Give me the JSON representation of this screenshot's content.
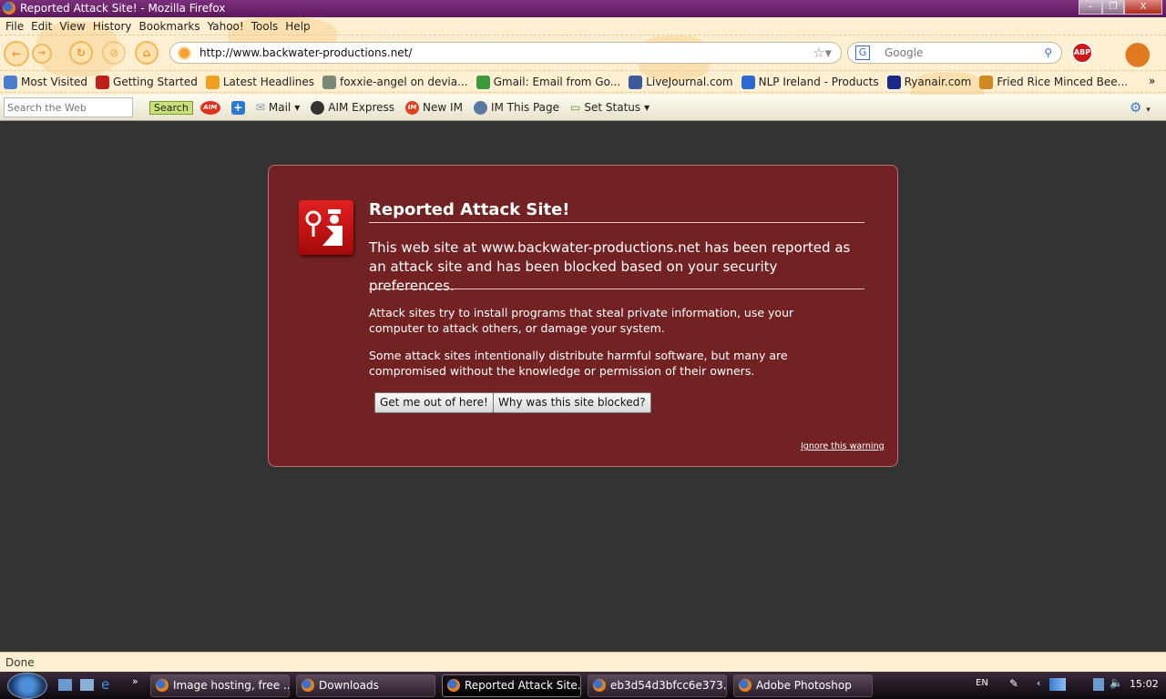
{
  "window": {
    "title": "Reported Attack Site! - Mozilla Firefox",
    "minimize": "–",
    "restore": "❐",
    "close": "X"
  },
  "menu": [
    "File",
    "Edit",
    "View",
    "History",
    "Bookmarks",
    "Yahoo!",
    "Tools",
    "Help"
  ],
  "nav": {
    "url": "http://www.backwater-productions.net/",
    "search_placeholder": "Google",
    "abp": "ABP"
  },
  "bookmarks": [
    {
      "label": "Most Visited",
      "color": "#4a7fd0"
    },
    {
      "label": "Getting Started",
      "color": "#c0201a"
    },
    {
      "label": "Latest Headlines",
      "color": "#f0a020"
    },
    {
      "label": "foxxie-angel on devia...",
      "color": "#7a8a7a"
    },
    {
      "label": "Gmail: Email from Go...",
      "color": "#3a9a3a"
    },
    {
      "label": "LiveJournal.com",
      "color": "#3a5a9a"
    },
    {
      "label": "NLP Ireland - Products",
      "color": "#2a6ad0"
    },
    {
      "label": "Ryanair.com",
      "color": "#1a2a8a"
    },
    {
      "label": "Fried Rice Minced Bee...",
      "color": "#d08a20"
    }
  ],
  "bookmarks_overflow": "»",
  "yahoo_toolbar": {
    "search_placeholder": "Search the Web",
    "search_button": "Search",
    "aim": "AIM",
    "items": [
      "Mail",
      "AIM Express",
      "New IM",
      "IM This Page",
      "Set Status"
    ]
  },
  "warning": {
    "title": "Reported Attack Site!",
    "main": "This web site at www.backwater-productions.net has been reported as an attack site and has been blocked based on your security preferences.",
    "para1": "Attack sites try to install programs that steal private information, use your computer to attack others, or damage your system.",
    "para2": "Some attack sites intentionally distribute harmful software, but many are compromised without the knowledge or permission of their owners.",
    "btn_escape": "Get me out of here!",
    "btn_why": "Why was this site blocked?",
    "ignore": "Ignore this warning",
    "bg_color": "#722223"
  },
  "status": "Done",
  "taskbar": {
    "tasks": [
      "Image hosting, free ...",
      "Downloads",
      "Reported Attack Site...",
      "eb3d54d3bfcc6e373...",
      "Adobe Photoshop"
    ],
    "lang": "EN",
    "time": "15:02"
  }
}
